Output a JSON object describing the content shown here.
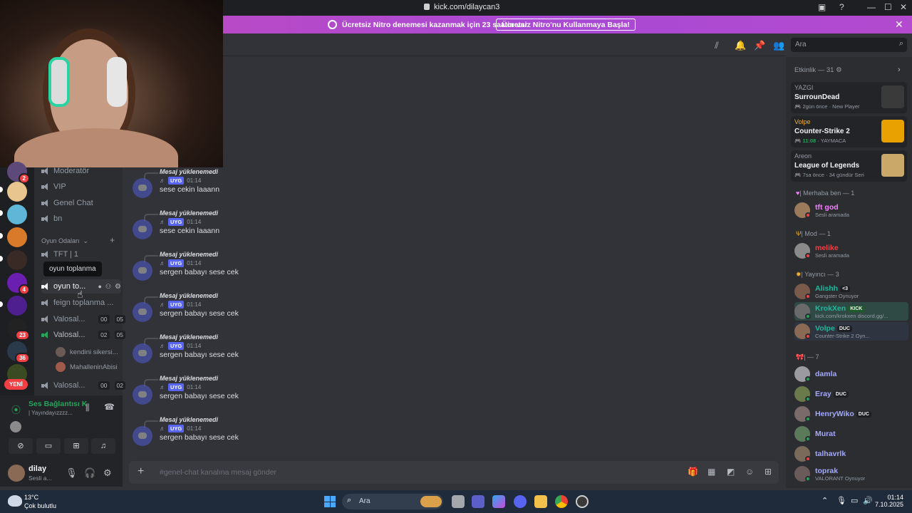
{
  "browser": {
    "url": "kick.com/dilaycan3"
  },
  "nitro": {
    "text": "Ücretsiz Nitro denemesi kazanmak için 23 saatin var",
    "button": "Ücretsiz Nitro'nu Kullanmaya Başla!"
  },
  "channels": {
    "items": [
      {
        "label": "Moderatör"
      },
      {
        "label": "VIP"
      },
      {
        "label": "Genel Chat"
      },
      {
        "label": "bn"
      }
    ],
    "category": "Oyun Odaları",
    "voice": [
      {
        "label": "TFT | 1"
      },
      {
        "label": "oyun to..."
      },
      {
        "label": "feign toplanma ..."
      },
      {
        "label": "Valosal...",
        "a": "00",
        "b": "05"
      },
      {
        "label": "Valosal...",
        "a": "02",
        "b": "05"
      },
      {
        "label": "Valosal...",
        "a": "00",
        "b": "02"
      }
    ],
    "voice_users": [
      "kendini sikersi...",
      "MahalleninAbisi"
    ],
    "tooltip": "oyun toplanma",
    "new_badge": "YENİ"
  },
  "server_badges": [
    "2",
    "4",
    "23",
    "36"
  ],
  "voice_panel": {
    "status": "Ses Bağlantısı K",
    "channel": "| Yayındayızzzz..."
  },
  "user": {
    "name": "dilay",
    "status": "Sesli a..."
  },
  "messages": [
    {
      "reply": "Mesaj yüklenemedi",
      "tag": "UYG",
      "time": "01:14",
      "text": "sese cekin laaann"
    },
    {
      "reply": "Mesaj yüklenemedi",
      "tag": "UYG",
      "time": "01:14",
      "text": "sese cekin laaann"
    },
    {
      "reply": "Mesaj yüklenemedi",
      "tag": "UYG",
      "time": "01:14",
      "text": "sergen babayı sese cek"
    },
    {
      "reply": "Mesaj yüklenemedi",
      "tag": "UYG",
      "time": "01:14",
      "text": "sergen babayı sese cek"
    },
    {
      "reply": "Mesaj yüklenemedi",
      "tag": "UYG",
      "time": "01:14",
      "text": "sergen babayı sese cek"
    },
    {
      "reply": "Mesaj yüklenemedi",
      "tag": "UYG",
      "time": "01:14",
      "text": "sergen babayı sese cek"
    },
    {
      "reply": "Mesaj yüklenemedi",
      "tag": "UYG",
      "time": "01:14",
      "text": "sergen babayı sese cek"
    }
  ],
  "composer": {
    "placeholder": "#genel-chat kanalına mesaj gönder"
  },
  "search": {
    "placeholder": "Ara"
  },
  "activity": {
    "header": "Etkinlik — 31",
    "cards": [
      {
        "user": "YAZGI",
        "game": "SurrounDead",
        "meta1": "2gün önce",
        "meta2": "New Player",
        "thumb": "#3a3a3a"
      },
      {
        "user": "Volpe",
        "game": "Counter-Strike 2",
        "meta1": "11:08",
        "meta2": "YAYMACA",
        "thumb": "#e8a100"
      },
      {
        "user": "Areon",
        "game": "League of Legends",
        "meta1": "7sa önce",
        "meta2": "34 gündür Seri",
        "thumb": "#c9a86a"
      }
    ]
  },
  "members": {
    "groups": [
      {
        "label": "| Merhaba ben — 1"
      },
      {
        "label": "| Mod — 1"
      },
      {
        "label": "| Yayıncı — 3"
      },
      {
        "label": "| — 7"
      }
    ],
    "list": [
      {
        "name": "tft god",
        "sub": "Sesli aramada",
        "color": "#f47fff"
      },
      {
        "name": "melike",
        "sub": "Sesli aramada",
        "color": "#f23f43"
      },
      {
        "name": "Alishh",
        "sub": "Gangster Oynuyor",
        "color": "#1fb89b",
        "tag": "<3"
      },
      {
        "name": "KrokXen",
        "sub": "kick.com/krokxen discord.gg/...",
        "color": "#1fb89b",
        "tag": "KICK"
      },
      {
        "name": "Volpe",
        "sub": "Counter-Strike 2 Oyn...",
        "color": "#1fb89b",
        "tag": "DUC"
      },
      {
        "name": "damla",
        "sub": "",
        "color": "#a4a8ff"
      },
      {
        "name": "Eray",
        "sub": "",
        "color": "#a4a8ff",
        "tag": "DUC"
      },
      {
        "name": "HenryWiko",
        "sub": "",
        "color": "#a4a8ff",
        "tag": "DUC"
      },
      {
        "name": "Murat",
        "sub": "",
        "color": "#a4a8ff"
      },
      {
        "name": "talhavrlk",
        "sub": "",
        "color": "#a4a8ff"
      },
      {
        "name": "toprak",
        "sub": "VALORANT Oynuyor",
        "color": "#a4a8ff"
      }
    ]
  },
  "taskbar": {
    "weather_temp": "13°C",
    "weather_desc": "Çok bulutlu",
    "search": "Ara",
    "time": "01:14",
    "date": "7.10.2025"
  }
}
